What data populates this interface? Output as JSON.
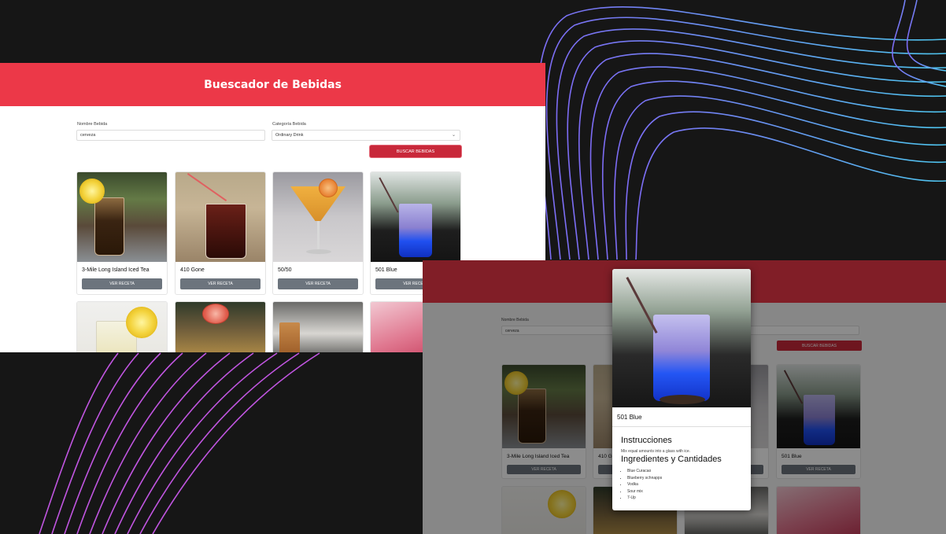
{
  "colors": {
    "accent": "#ec3848",
    "button_dark": "#c8283a",
    "card_button": "#6c747d",
    "background": "#161616"
  },
  "app": {
    "title": "Buescador de Bebidas"
  },
  "form": {
    "name_label": "Nombre Bebida",
    "name_value": "cerveza",
    "category_label": "Categoría Bebida",
    "category_value": "Ordinary Drink",
    "search_button": "BUSCAR BEBIDAS"
  },
  "drinks": [
    {
      "name": "3-Mile Long Island Iced Tea",
      "button": "VER RECETA"
    },
    {
      "name": "410 Gone",
      "button": "VER RECETA"
    },
    {
      "name": "50/50",
      "button": "VER RECETA"
    },
    {
      "name": "501 Blue",
      "button": "VER RECETA"
    }
  ],
  "screen2": {
    "name_label": "Nombre Bebida",
    "name_value": "cerveza",
    "search_button": "BUSCAR BEBIDAS",
    "drinks": [
      {
        "name": "3-Mile Long Island Iced Tea",
        "button": "VER RECETA"
      },
      {
        "name": "410 G",
        "button": "VER RECETA"
      },
      {
        "name": "501 Blue",
        "button": "VER RECETA"
      }
    ]
  },
  "modal": {
    "title": "501 Blue",
    "instructions_heading": "Instrucciones",
    "instructions_text": "Mix equal amounts into a glass with ice.",
    "ingredients_heading": "Ingredientes y Cantidades",
    "ingredients": [
      "Blue Curacao",
      "Blueberry schnapps",
      "Vodka",
      "Sour mix",
      "7-Up"
    ]
  }
}
